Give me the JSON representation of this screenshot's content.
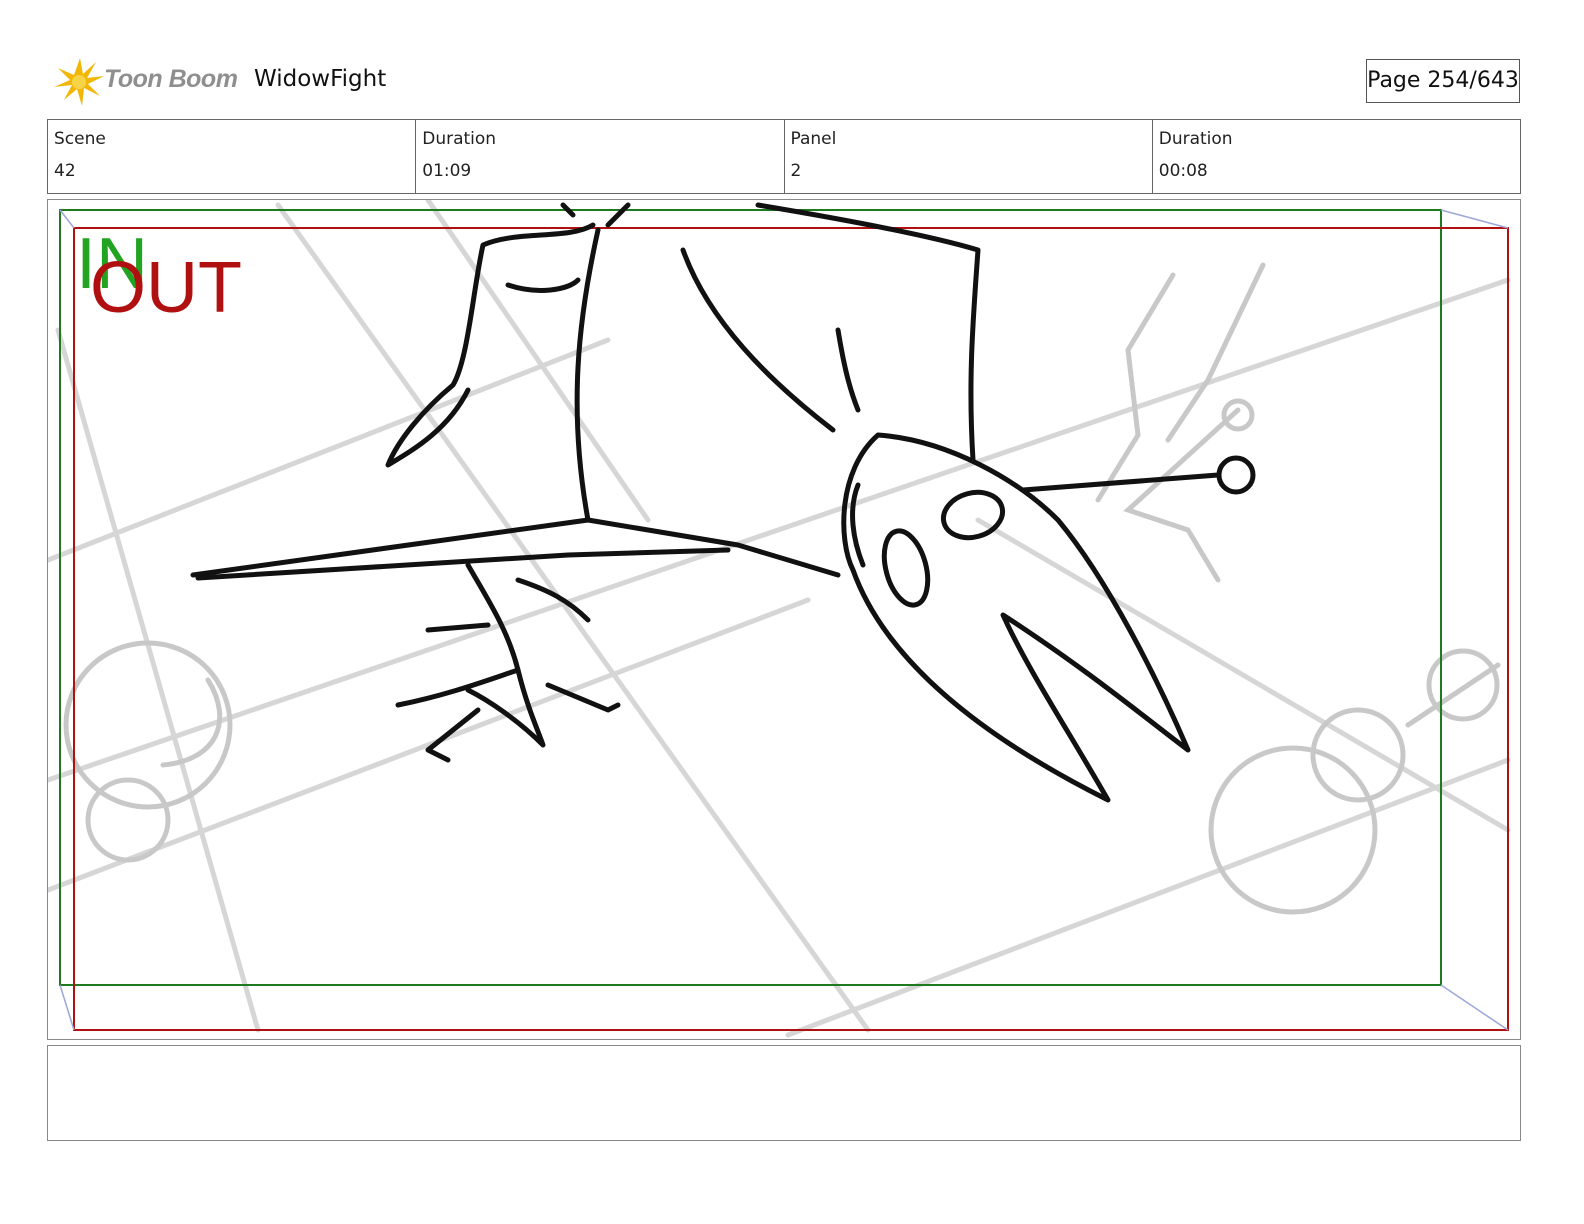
{
  "header": {
    "logo_text": "Toon Boom",
    "project_title": "WidowFight",
    "page_label": "Page 254/643"
  },
  "info": {
    "scene_label": "Scene",
    "scene_value": "42",
    "scene_duration_label": "Duration",
    "scene_duration_value": "01:09",
    "panel_label": "Panel",
    "panel_value": "2",
    "panel_duration_label": "Duration",
    "panel_duration_value": "00:08"
  },
  "panel": {
    "in_label": "IN",
    "out_label": "OUT",
    "in_frame_color": "#1f7a1f",
    "out_frame_color": "#b01010"
  },
  "notes": {
    "text": ""
  }
}
